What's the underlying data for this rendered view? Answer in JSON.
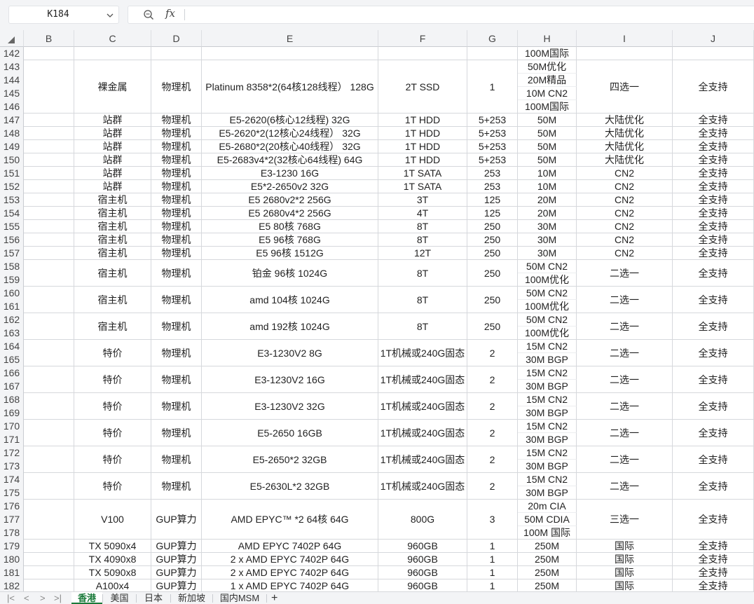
{
  "formula_bar": {
    "name_box": "K184",
    "fx_label": "fx",
    "formula": ""
  },
  "columns": [
    "B",
    "C",
    "D",
    "E",
    "F",
    "G",
    "H",
    "I",
    "J"
  ],
  "row_numbers": [
    142,
    143,
    144,
    145,
    146,
    147,
    148,
    149,
    150,
    151,
    152,
    153,
    154,
    155,
    156,
    157,
    158,
    159,
    160,
    161,
    162,
    163,
    164,
    165,
    166,
    167,
    168,
    169,
    170,
    171,
    172,
    173,
    174,
    175,
    176,
    177,
    178,
    179,
    180,
    181,
    182
  ],
  "groups": [
    {
      "rows": [
        142,
        142
      ],
      "C": "",
      "D": "",
      "E": "",
      "F": "",
      "G": "",
      "H": [
        "100M国际"
      ],
      "I": "",
      "J": ""
    },
    {
      "rows": [
        143,
        146
      ],
      "C": "裸金属",
      "D": "物理机",
      "E": "Platinum 8358*2(64核128线程） 128G",
      "F": "2T SSD",
      "G": "1",
      "H": [
        "50M优化",
        "20M精品",
        "10M CN2",
        "100M国际"
      ],
      "I": "四选一",
      "J": "全支持"
    },
    {
      "rows": [
        147,
        147
      ],
      "C": "站群",
      "D": "物理机",
      "E": "E5-2620(6核心12线程) 32G",
      "F": "1T HDD",
      "G": "5+253",
      "H": [
        "50M"
      ],
      "I": "大陆优化",
      "J": "全支持"
    },
    {
      "rows": [
        148,
        148
      ],
      "C": "站群",
      "D": "物理机",
      "E": "E5-2620*2(12核心24线程） 32G",
      "F": "1T HDD",
      "G": "5+253",
      "H": [
        "50M"
      ],
      "I": "大陆优化",
      "J": "全支持"
    },
    {
      "rows": [
        149,
        149
      ],
      "C": "站群",
      "D": "物理机",
      "E": "E5-2680*2(20核心40线程） 32G",
      "F": "1T HDD",
      "G": "5+253",
      "H": [
        "50M"
      ],
      "I": "大陆优化",
      "J": "全支持"
    },
    {
      "rows": [
        150,
        150
      ],
      "C": "站群",
      "D": "物理机",
      "E": "E5-2683v4*2(32核心64线程) 64G",
      "F": "1T HDD",
      "G": "5+253",
      "H": [
        "50M"
      ],
      "I": "大陆优化",
      "J": "全支持"
    },
    {
      "rows": [
        151,
        151
      ],
      "C": "站群",
      "D": "物理机",
      "E": "E3-1230 16G",
      "F": "1T SATA",
      "G": "253",
      "H": [
        "10M"
      ],
      "I": "CN2",
      "J": "全支持"
    },
    {
      "rows": [
        152,
        152
      ],
      "C": "站群",
      "D": "物理机",
      "E": "E5*2-2650v2 32G",
      "F": "1T SATA",
      "G": "253",
      "H": [
        "10M"
      ],
      "I": "CN2",
      "J": "全支持"
    },
    {
      "rows": [
        153,
        153
      ],
      "C": "宿主机",
      "D": "物理机",
      "E": "E5 2680v2*2  256G",
      "F": "3T",
      "G": "125",
      "H": [
        "20M"
      ],
      "I": "CN2",
      "J": "全支持"
    },
    {
      "rows": [
        154,
        154
      ],
      "C": "宿主机",
      "D": "物理机",
      "E": "E5 2680v4*2 256G",
      "F": "4T",
      "G": "125",
      "H": [
        "20M"
      ],
      "I": "CN2",
      "J": "全支持"
    },
    {
      "rows": [
        155,
        155
      ],
      "C": "宿主机",
      "D": "物理机",
      "E": "E5 80核  768G",
      "F": "8T",
      "G": "250",
      "H": [
        "30M"
      ],
      "I": "CN2",
      "J": "全支持"
    },
    {
      "rows": [
        156,
        156
      ],
      "C": "宿主机",
      "D": "物理机",
      "E": "E5 96核  768G",
      "F": "8T",
      "G": "250",
      "H": [
        "30M"
      ],
      "I": "CN2",
      "J": "全支持"
    },
    {
      "rows": [
        157,
        157
      ],
      "C": "宿主机",
      "D": "物理机",
      "E": "E5  96核 1512G",
      "F": "12T",
      "G": "250",
      "H": [
        "30M"
      ],
      "I": "CN2",
      "J": "全支持"
    },
    {
      "rows": [
        158,
        159
      ],
      "C": "宿主机",
      "D": "物理机",
      "E": "铂金 96核 1024G",
      "F": "8T",
      "G": "250",
      "H": [
        "50M CN2",
        "100M优化"
      ],
      "I": "二选一",
      "J": "全支持"
    },
    {
      "rows": [
        160,
        161
      ],
      "C": "宿主机",
      "D": "物理机",
      "E": "amd 104核 1024G",
      "F": "8T",
      "G": "250",
      "H": [
        "50M CN2",
        "100M优化"
      ],
      "I": "二选一",
      "J": "全支持"
    },
    {
      "rows": [
        162,
        163
      ],
      "C": "宿主机",
      "D": "物理机",
      "E": "amd 192核 1024G",
      "F": "8T",
      "G": "250",
      "H": [
        "50M CN2",
        "100M优化"
      ],
      "I": "二选一",
      "J": "全支持"
    },
    {
      "rows": [
        164,
        165
      ],
      "C": "特价",
      "D": "物理机",
      "E": "E3-1230V2 8G",
      "F": "1T机械或240G固态",
      "G": "2",
      "H": [
        "15M CN2",
        "30M BGP"
      ],
      "I": "二选一",
      "J": "全支持"
    },
    {
      "rows": [
        166,
        167
      ],
      "C": "特价",
      "D": "物理机",
      "E": "E3-1230V2 16G",
      "F": "1T机械或240G固态",
      "G": "2",
      "H": [
        "15M CN2",
        "30M BGP"
      ],
      "I": "二选一",
      "J": "全支持"
    },
    {
      "rows": [
        168,
        169
      ],
      "C": "特价",
      "D": "物理机",
      "E": "E3-1230V2 32G",
      "F": "1T机械或240G固态",
      "G": "2",
      "H": [
        "15M CN2",
        "30M BGP"
      ],
      "I": "二选一",
      "J": "全支持"
    },
    {
      "rows": [
        170,
        171
      ],
      "C": "特价",
      "D": "物理机",
      "E": "E5-2650 16GB",
      "F": "1T机械或240G固态",
      "G": "2",
      "H": [
        "15M CN2",
        "30M BGP"
      ],
      "I": "二选一",
      "J": "全支持"
    },
    {
      "rows": [
        172,
        173
      ],
      "C": "特价",
      "D": "物理机",
      "E": "E5-2650*2 32GB",
      "F": "1T机械或240G固态",
      "G": "2",
      "H": [
        "15M CN2",
        "30M BGP"
      ],
      "I": "二选一",
      "J": "全支持"
    },
    {
      "rows": [
        174,
        175
      ],
      "C": "特价",
      "D": "物理机",
      "E": "E5-2630L*2 32GB",
      "F": "1T机械或240G固态",
      "G": "2",
      "H": [
        "15M CN2",
        "30M BGP"
      ],
      "I": "二选一",
      "J": "全支持"
    },
    {
      "rows": [
        176,
        178
      ],
      "C": "V100",
      "D": "GUP算力",
      "E": "AMD EPYC™ *2 64核  64G",
      "F": "800G",
      "G": "3",
      "H": [
        "20m CIA",
        "50M CDIA",
        "100M 国际"
      ],
      "I": "三选一",
      "J": "全支持"
    },
    {
      "rows": [
        179,
        179
      ],
      "C": "TX 5090x4",
      "D": "GUP算力",
      "E": "AMD EPYC 7402P    64G",
      "F": "960GB",
      "G": "1",
      "H": [
        "250M"
      ],
      "I": "国际",
      "J": "全支持"
    },
    {
      "rows": [
        180,
        180
      ],
      "C": "TX 4090x8",
      "D": "GUP算力",
      "E": "2 x AMD EPYC 7402P    64G",
      "F": "960GB",
      "G": "1",
      "H": [
        "250M"
      ],
      "I": "国际",
      "J": "全支持"
    },
    {
      "rows": [
        181,
        181
      ],
      "C": "TX 5090x8",
      "D": "GUP算力",
      "E": "2 x AMD EPYC 7402P 64G",
      "F": "960GB",
      "G": "1",
      "H": [
        "250M"
      ],
      "I": "国际",
      "J": "全支持"
    },
    {
      "rows": [
        182,
        182
      ],
      "C": "A100x4",
      "D": "GUP算力",
      "E": "1 x AMD EPYC 7402P    64G",
      "F": "960GB",
      "G": "1",
      "H": [
        "250M"
      ],
      "I": "国际",
      "J": "全支持"
    }
  ],
  "sheet_tabs": [
    {
      "label": "香港",
      "active": true
    },
    {
      "label": "美国",
      "active": false
    },
    {
      "label": "日本",
      "active": false
    },
    {
      "label": "新加坡",
      "active": false
    },
    {
      "label": "国内MSM",
      "active": false
    }
  ],
  "add_sheet_label": "+",
  "colors": {
    "active_tab": "#1a7a3a",
    "header_bg": "#f3f4f6",
    "grid": "#d6d8dc"
  }
}
